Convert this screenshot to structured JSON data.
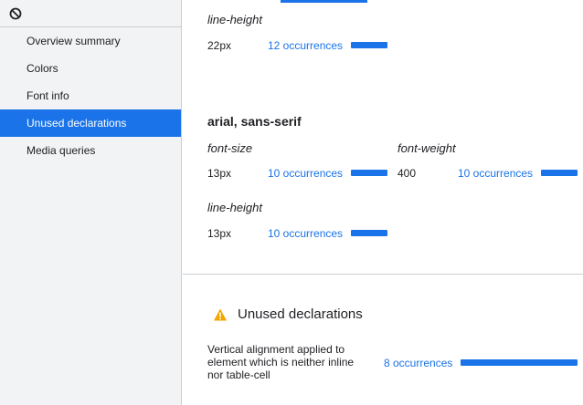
{
  "sidebar": {
    "items": [
      {
        "label": "Overview summary"
      },
      {
        "label": "Colors"
      },
      {
        "label": "Font info"
      },
      {
        "label": "Unused declarations"
      },
      {
        "label": "Media queries"
      }
    ],
    "selected_index": 3
  },
  "font_info": {
    "previous_block": {
      "line_height_label": "line-height",
      "line_height_value": "22px",
      "line_height_occurrences": "12 occurrences"
    },
    "arial_block": {
      "family": "arial, sans-serif",
      "font_size_label": "font-size",
      "font_size_value": "13px",
      "font_size_occurrences": "10 occurrences",
      "font_weight_label": "font-weight",
      "font_weight_value": "400",
      "font_weight_occurrences": "10 occurrences",
      "line_height_label": "line-height",
      "line_height_value": "13px",
      "line_height_occurrences": "10 occurrences"
    }
  },
  "unused": {
    "title": "Unused declarations",
    "row": {
      "description": "Vertical alignment applied to element which is neither inline nor table-cell",
      "occurrences": "8 occurrences"
    }
  },
  "colors": {
    "accent": "#1a73e8",
    "warning": "#f2a600",
    "sidebar_bg": "#f1f3f4"
  },
  "icons": {
    "clear": "clear-icon",
    "warning": "warning-icon"
  }
}
